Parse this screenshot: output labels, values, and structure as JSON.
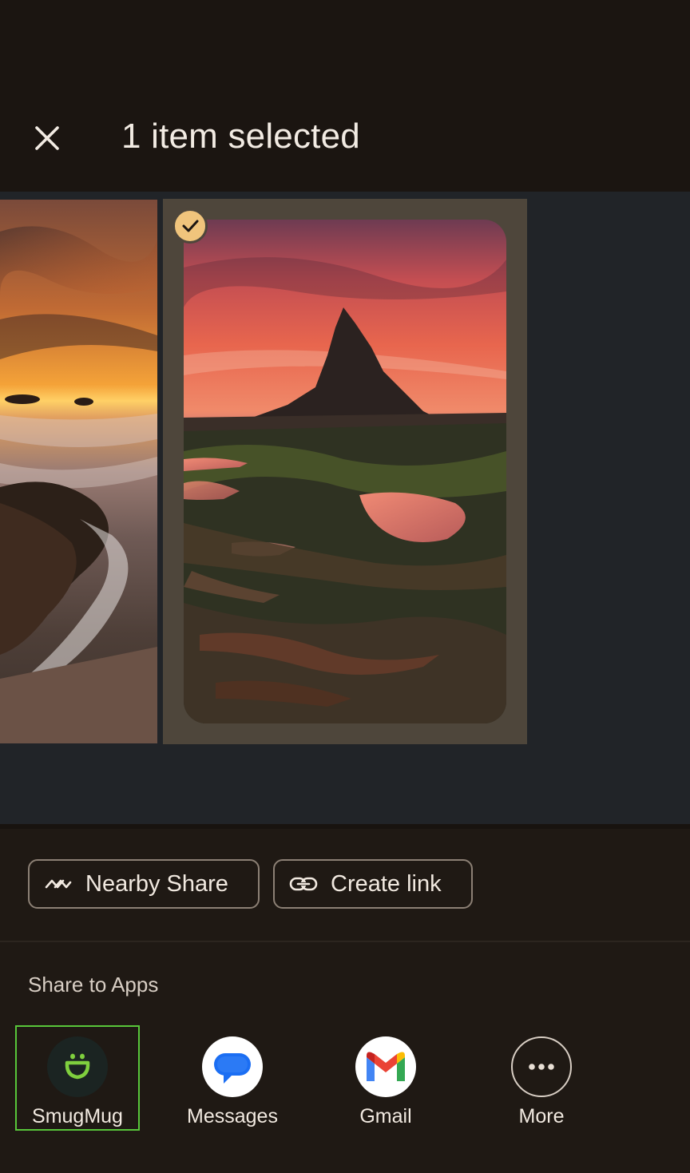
{
  "header": {
    "title": "1 item selected",
    "close_icon": "close-icon"
  },
  "gallery": {
    "selected_check_icon": "check-icon",
    "accent_check_color": "#f0c47c"
  },
  "share_actions": {
    "nearby_share": {
      "label": "Nearby Share",
      "icon": "nearby-share-icon"
    },
    "create_link": {
      "label": "Create link",
      "icon": "link-icon"
    }
  },
  "share_to_apps": {
    "section_label": "Share to Apps",
    "apps": [
      {
        "label": "SmugMug",
        "icon": "smugmug-icon",
        "highlight_color": "#58c63a"
      },
      {
        "label": "Messages",
        "icon": "messages-icon"
      },
      {
        "label": "Gmail",
        "icon": "gmail-icon"
      },
      {
        "label": "More",
        "icon": "more-icon"
      }
    ]
  }
}
